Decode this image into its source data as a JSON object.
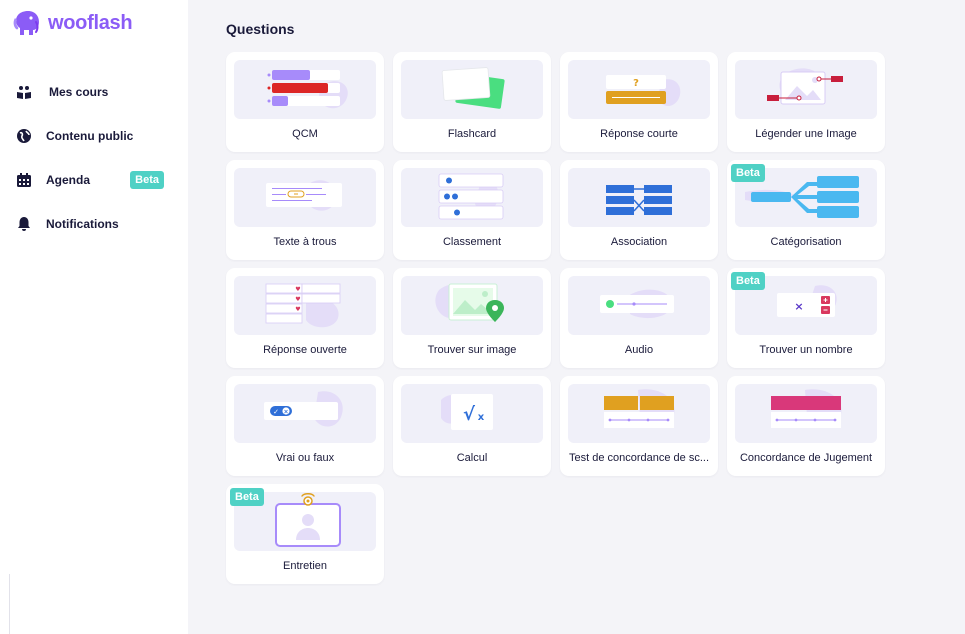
{
  "app": {
    "name": "wooflash"
  },
  "colors": {
    "brand": "#8b5cf6",
    "beta": "#4fd1c5",
    "background": "#f4f4f8"
  },
  "sidebar": {
    "items": [
      {
        "label": "Mes cours",
        "icon": "courses-icon"
      },
      {
        "label": "Contenu public",
        "icon": "globe-icon"
      },
      {
        "label": "Agenda",
        "icon": "calendar-icon",
        "badge": "Beta"
      },
      {
        "label": "Notifications",
        "icon": "bell-icon"
      }
    ]
  },
  "main": {
    "title": "Questions",
    "beta_label": "Beta",
    "cards": [
      {
        "label": "QCM"
      },
      {
        "label": "Flashcard"
      },
      {
        "label": "Réponse courte"
      },
      {
        "label": "Légender une Image"
      },
      {
        "label": "Texte à trous"
      },
      {
        "label": "Classement"
      },
      {
        "label": "Association"
      },
      {
        "label": "Catégorisation",
        "beta": true
      },
      {
        "label": "Réponse ouverte"
      },
      {
        "label": "Trouver sur image"
      },
      {
        "label": "Audio"
      },
      {
        "label": "Trouver un nombre",
        "beta": true
      },
      {
        "label": "Vrai ou faux"
      },
      {
        "label": "Calcul"
      },
      {
        "label": "Test de concordance de sc..."
      },
      {
        "label": "Concordance de Jugement"
      },
      {
        "label": "Entretien",
        "beta": true
      }
    ]
  }
}
